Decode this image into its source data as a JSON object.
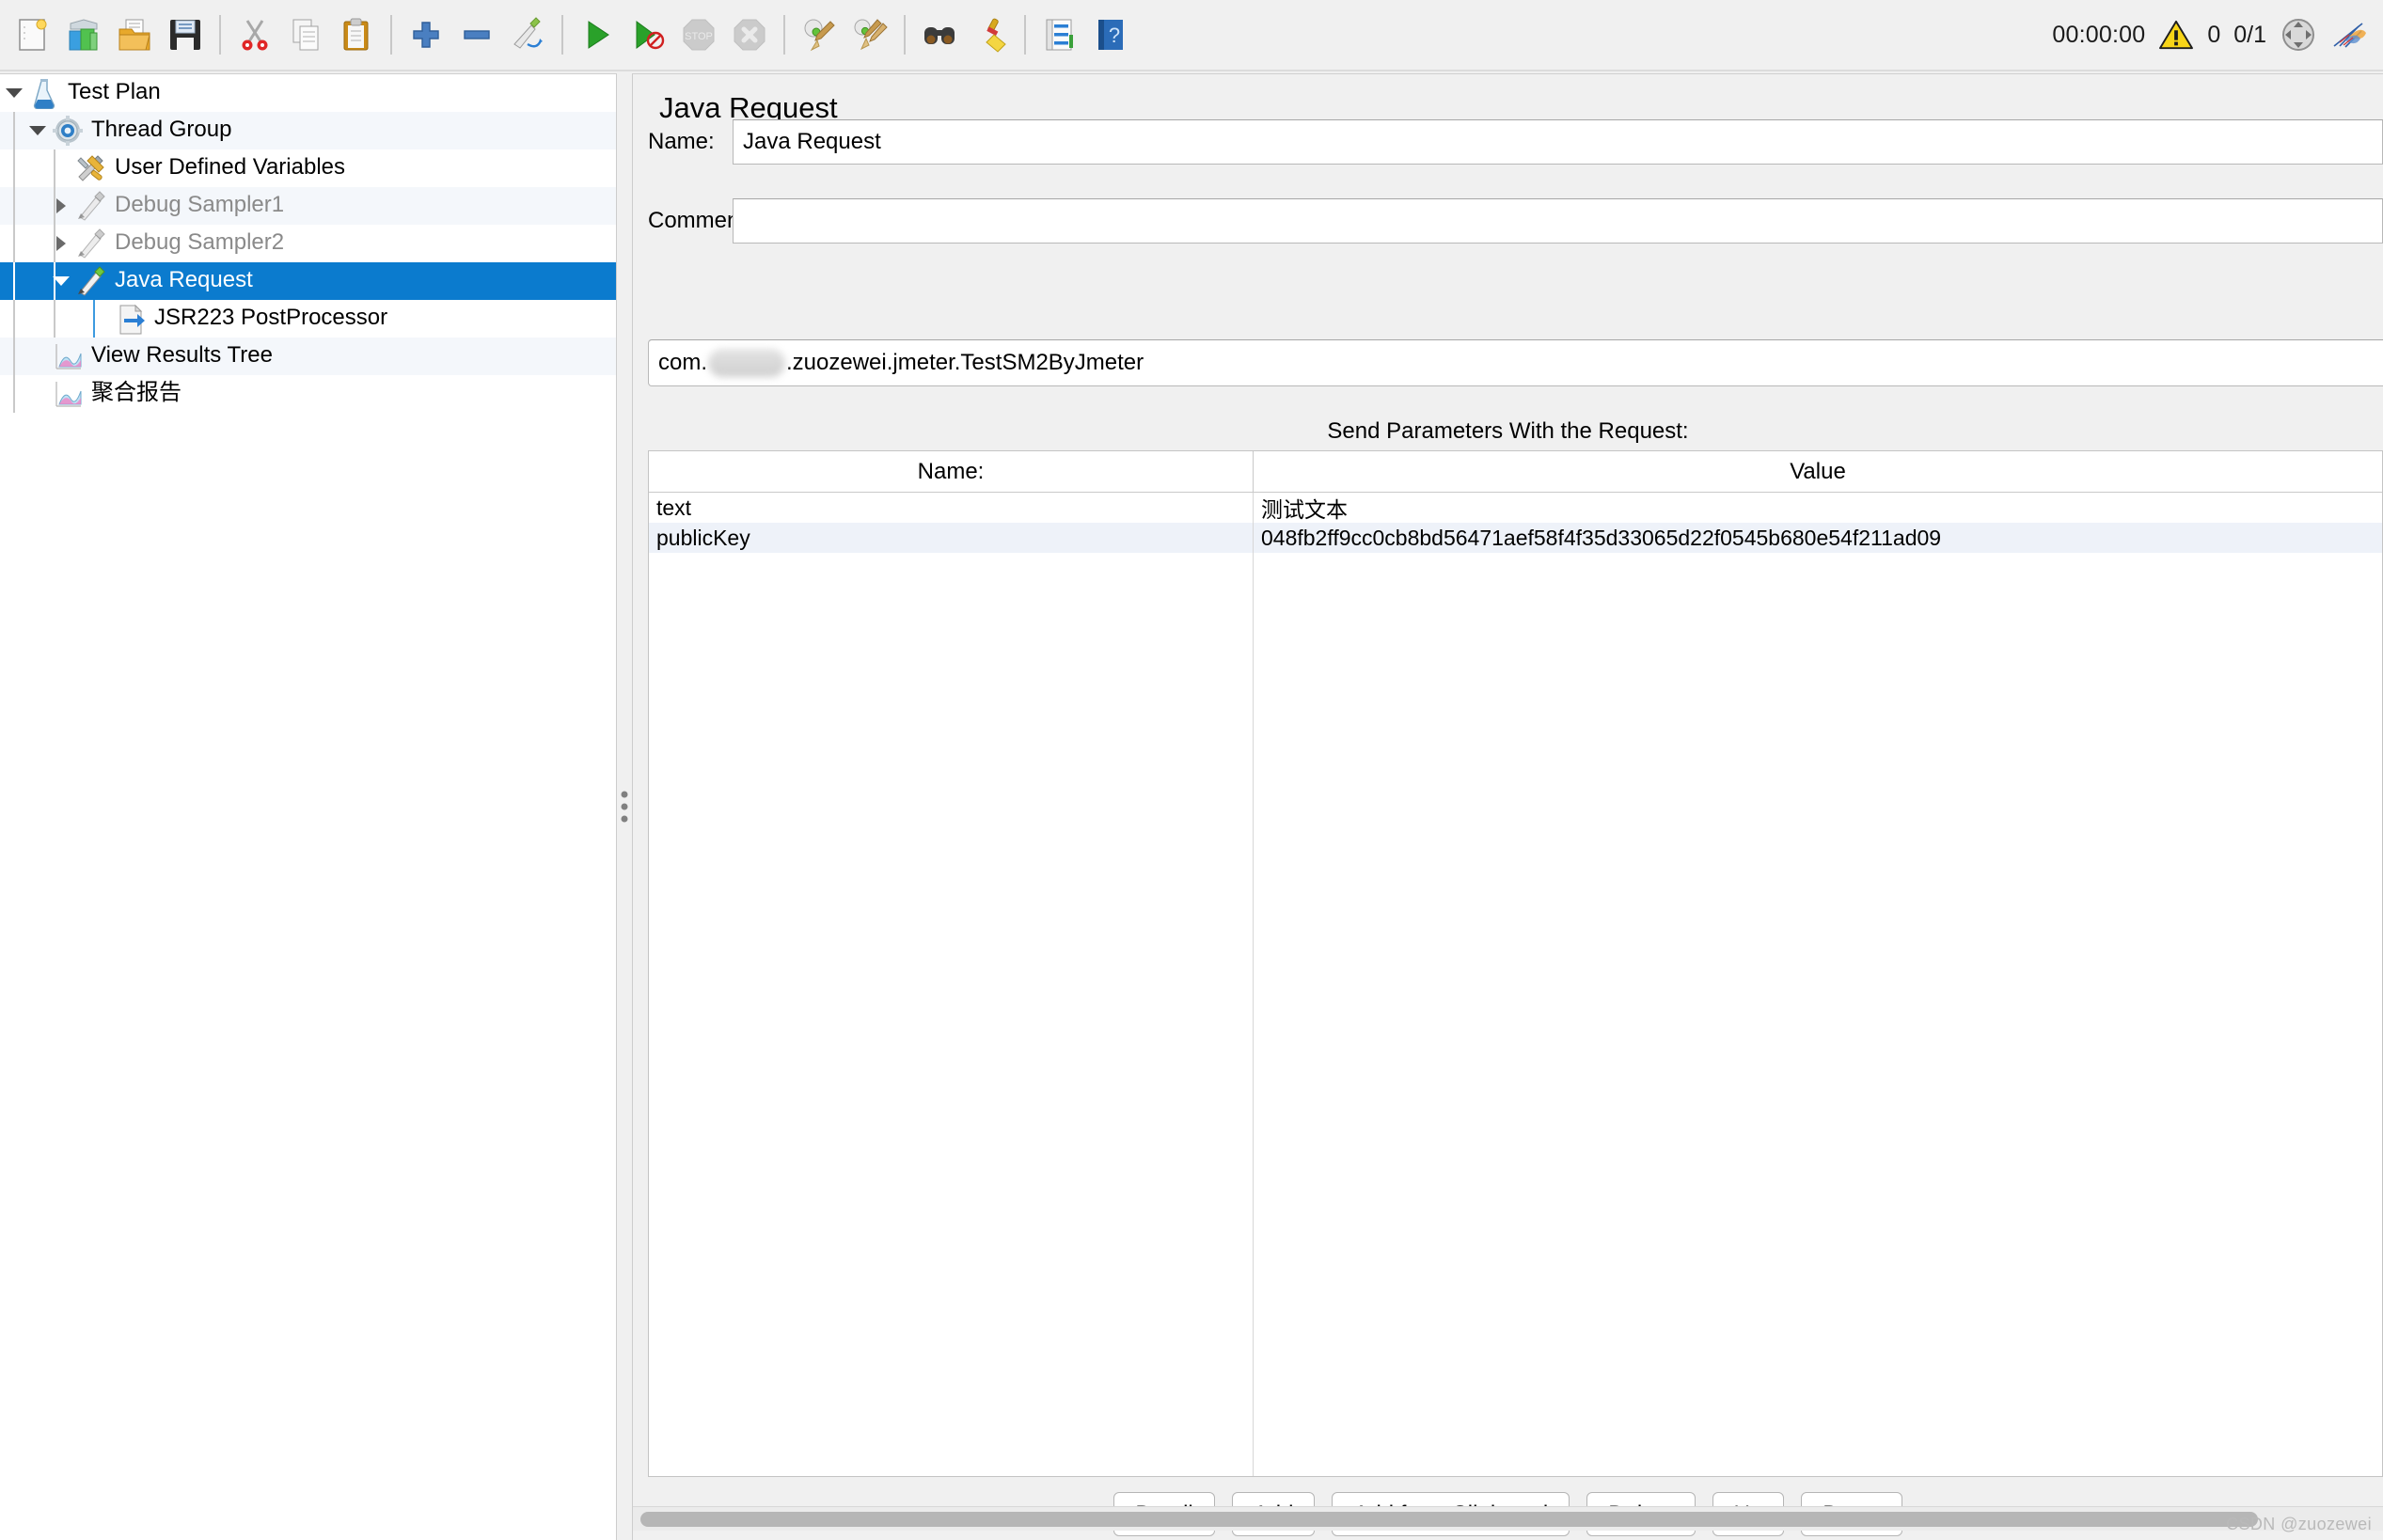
{
  "toolbar": {
    "left_icons": [
      {
        "name": "new-icon",
        "label": "New"
      },
      {
        "name": "templates-icon",
        "label": "Templates"
      },
      {
        "name": "open-icon",
        "label": "Open"
      },
      {
        "name": "save-icon",
        "label": "Save Test Plan"
      },
      {
        "name": "cut-icon",
        "label": "Cut"
      },
      {
        "name": "copy-icon",
        "label": "Copy"
      },
      {
        "name": "paste-icon",
        "label": "Paste"
      },
      {
        "name": "expand-all-icon",
        "label": "Expand All"
      },
      {
        "name": "collapse-all-icon",
        "label": "Collapse All"
      },
      {
        "name": "toggle-icon",
        "label": "Toggle"
      },
      {
        "name": "start-icon",
        "label": "Start"
      },
      {
        "name": "start-no-pauses-icon",
        "label": "Start no pauses"
      },
      {
        "name": "stop-icon",
        "label": "Stop"
      },
      {
        "name": "shutdown-icon",
        "label": "Shutdown"
      },
      {
        "name": "clear-icon",
        "label": "Clear"
      },
      {
        "name": "clear-all-icon",
        "label": "Clear All"
      },
      {
        "name": "search-icon",
        "label": "Search"
      },
      {
        "name": "reset-search-icon",
        "label": "Reset Search"
      },
      {
        "name": "function-helper-icon",
        "label": "Function Helper Dialog"
      },
      {
        "name": "help-icon",
        "label": "Help"
      }
    ],
    "status": {
      "elapsed_time": "00:00:00",
      "warning_count": "0",
      "thread_counts": "0/1",
      "warning_icon": "warning-triangle-icon",
      "connect_icon": "remote-connect-icon",
      "logo_icon": "jmeter-feather-icon"
    }
  },
  "tree": {
    "items": [
      {
        "label": "Test Plan",
        "icon": "test-plan-icon",
        "depth": 0,
        "toggle": "down",
        "state": "normal",
        "zebra": "white"
      },
      {
        "label": "Thread Group",
        "icon": "thread-group-icon",
        "depth": 1,
        "toggle": "down",
        "state": "normal",
        "zebra": "alt"
      },
      {
        "label": "User Defined Variables",
        "icon": "user-variables-icon",
        "depth": 2,
        "toggle": "none",
        "state": "normal",
        "zebra": "white"
      },
      {
        "label": "Debug Sampler1",
        "icon": "sampler-icon",
        "depth": 2,
        "toggle": "right",
        "state": "disabled",
        "zebra": "alt"
      },
      {
        "label": "Debug Sampler2",
        "icon": "sampler-icon",
        "depth": 2,
        "toggle": "right",
        "state": "disabled",
        "zebra": "white"
      },
      {
        "label": "Java Request",
        "icon": "sampler-icon",
        "depth": 2,
        "toggle": "down",
        "state": "selected",
        "zebra": "sel"
      },
      {
        "label": "JSR223 PostProcessor",
        "icon": "post-processor-icon",
        "depth": 3,
        "toggle": "none",
        "state": "normal",
        "zebra": "white"
      },
      {
        "label": "View Results Tree",
        "icon": "listener-icon",
        "depth": 1,
        "toggle": "none",
        "state": "normal",
        "zebra": "alt"
      },
      {
        "label": "聚合报告",
        "icon": "listener-icon",
        "depth": 1,
        "toggle": "none",
        "state": "normal",
        "zebra": "white"
      }
    ]
  },
  "main": {
    "title": "Java Request",
    "name_label": "Name:",
    "name_value": "Java Request",
    "comments_label": "Comments:",
    "comments_value": "",
    "classname_prefix": "com.",
    "classname_suffix": ".zuozewei.jmeter.TestSM2ByJmeter",
    "send_params_label": "Send Parameters With the Request:",
    "table": {
      "columns": [
        "Name:",
        "Value"
      ],
      "rows": [
        {
          "name": "text",
          "value": "测试文本"
        },
        {
          "name": "publicKey",
          "value": "048fb2ff9cc0cb8bd56471aef58f4f35d33065d22f0545b680e54f211ad09"
        }
      ]
    },
    "buttons": [
      {
        "name": "detail-button",
        "label": "Detail"
      },
      {
        "name": "add-button",
        "label": "Add"
      },
      {
        "name": "add-from-clipboard-button",
        "label": "Add from Clipboard"
      },
      {
        "name": "delete-button",
        "label": "Delete"
      },
      {
        "name": "up-button",
        "label": "Up"
      },
      {
        "name": "down-button",
        "label": "Down"
      }
    ]
  },
  "watermark": "CSDN @zuozewei",
  "colors": {
    "selection_blue": "#0b7bce",
    "panel_bg": "#f0f0f0",
    "row_alt": "#f4f7fb",
    "table_row_alt": "#eef2f9",
    "disabled_text": "#8a8a8a"
  }
}
